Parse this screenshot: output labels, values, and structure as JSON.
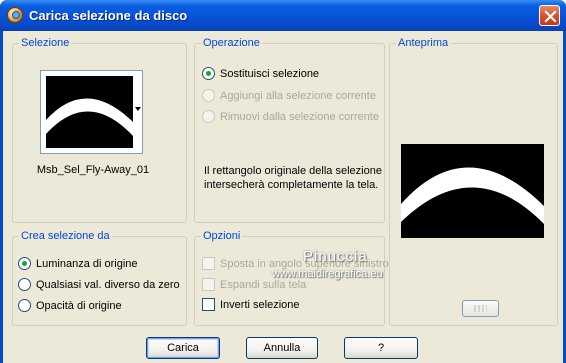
{
  "window": {
    "title": "Carica selezione da disco"
  },
  "selezione": {
    "label": "Selezione",
    "selected_file": "Msb_Sel_Fly-Away_01"
  },
  "operazione": {
    "label": "Operazione",
    "options": [
      {
        "label": "Sostituisci selezione",
        "checked": true,
        "enabled": true
      },
      {
        "label": "Aggiungi alla selezione corrente",
        "checked": false,
        "enabled": false
      },
      {
        "label": "Rimuovi dalla selezione corrente",
        "checked": false,
        "enabled": false
      }
    ],
    "description": "Il rettangolo originale della selezione intersecherà completamente la tela."
  },
  "anteprima": {
    "label": "Anteprima"
  },
  "crea_selezione": {
    "label": "Crea selezione da",
    "options": [
      {
        "label": "Luminanza di origine",
        "checked": true
      },
      {
        "label": "Qualsiasi val. diverso da zero",
        "checked": false
      },
      {
        "label": "Opacità di origine",
        "checked": false
      }
    ]
  },
  "opzioni": {
    "label": "Opzioni",
    "items": [
      {
        "label": "Sposta in angolo superiore sinistro",
        "checked": false,
        "enabled": false
      },
      {
        "label": "Espandi sulla tela",
        "checked": false,
        "enabled": false
      },
      {
        "label": "Inverti selezione",
        "checked": false,
        "enabled": true
      }
    ]
  },
  "buttons": {
    "load": "Carica",
    "cancel": "Annulla",
    "help": "?"
  },
  "watermark": {
    "name": "Pinuccia",
    "site": "www.maidiregrafica.eu"
  },
  "colors": {
    "titlebar": "#0852d9",
    "group_label": "#0046d5",
    "dialog_bg": "#ece9d8",
    "radio_dot": "#21a121"
  }
}
